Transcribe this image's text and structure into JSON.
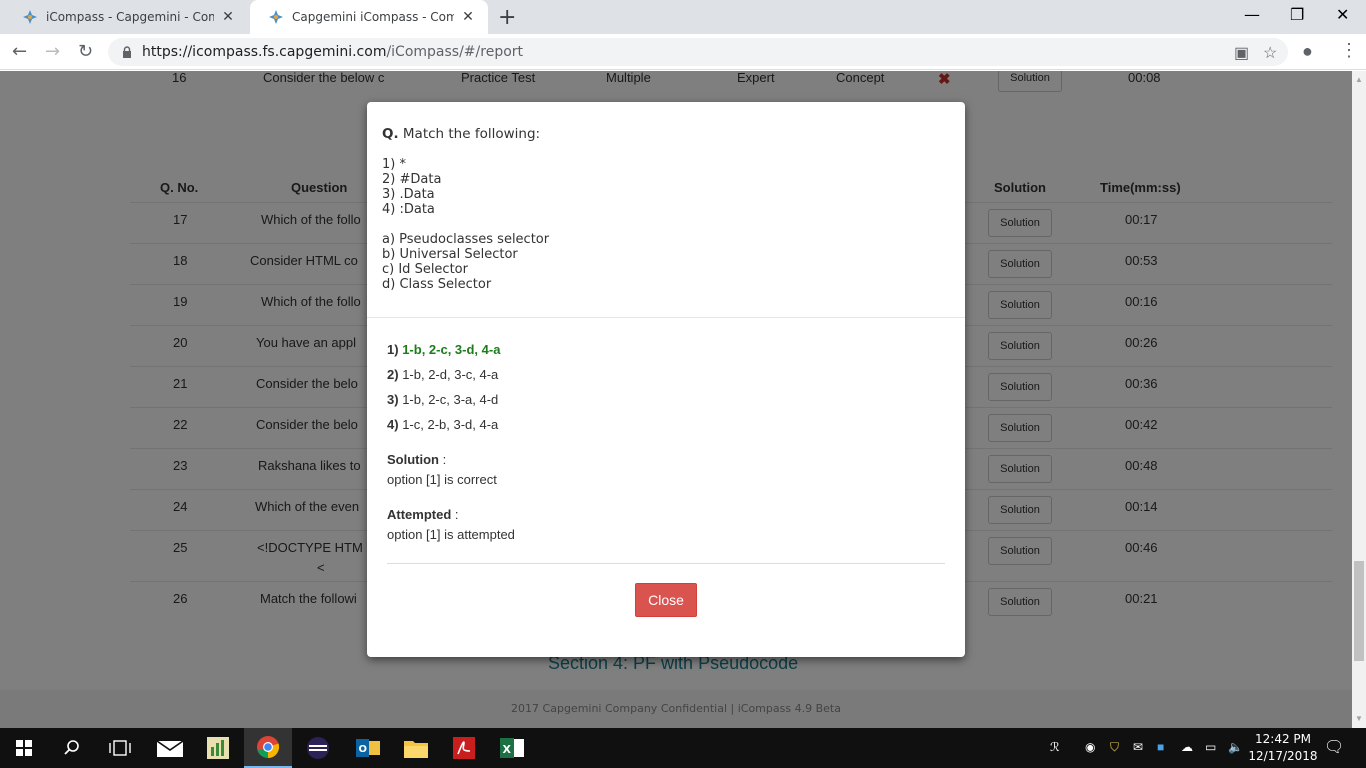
{
  "browser": {
    "tabs": [
      {
        "title": "iCompass - Capgemini - Compet"
      },
      {
        "title": "Capgemini iCompass - Compete"
      }
    ],
    "url_host": "https://icompass.fs.capgemini.com",
    "url_path": "/iCompass/#/report"
  },
  "table": {
    "top_row": {
      "qno": "16",
      "question": "Consider the below c",
      "test": "Practice Test",
      "type": "Multiple",
      "level": "Expert",
      "category": "Concept",
      "solution": "Solution",
      "time": "00:08"
    },
    "headers": {
      "qno": "Q. No.",
      "question": "Question",
      "solution": "Solution",
      "time": "Time(mm:ss)"
    },
    "rows": [
      {
        "qno": "17",
        "question": "Which of the follo",
        "solution": "Solution",
        "time": "00:17"
      },
      {
        "qno": "18",
        "question": "Consider HTML co",
        "solution": "Solution",
        "time": "00:53"
      },
      {
        "qno": "19",
        "question": "Which of the follo",
        "solution": "Solution",
        "time": "00:16"
      },
      {
        "qno": "20",
        "question": "You have an appl",
        "solution": "Solution",
        "time": "00:26"
      },
      {
        "qno": "21",
        "question": "Consider the belo",
        "solution": "Solution",
        "time": "00:36"
      },
      {
        "qno": "22",
        "question": "Consider the belo",
        "solution": "Solution",
        "time": "00:42"
      },
      {
        "qno": "23",
        "question": "Rakshana likes to",
        "solution": "Solution",
        "time": "00:48"
      },
      {
        "qno": "24",
        "question": "Which of the even",
        "solution": "Solution",
        "time": "00:14"
      },
      {
        "qno": "25",
        "question": "<!DOCTYPE HTM",
        "question2": "<",
        "solution": "Solution",
        "time": "00:46"
      },
      {
        "qno": "26",
        "question": "Match the followi",
        "solution": "Solution",
        "time": "00:21"
      }
    ],
    "section_title": "Section 4: PF with Pseudocode"
  },
  "footer": "2017 Capgemini Company Confidential | iCompass 4.9 Beta",
  "modal": {
    "q_prefix": "Q.",
    "q_text": "Match the following:",
    "items": [
      "1) *",
      "2) #Data",
      "3) .Data",
      "4) :Data"
    ],
    "choices": [
      "a) Pseudoclasses selector",
      "b) Universal Selector",
      "c) Id Selector",
      "d) Class Selector"
    ],
    "options": [
      {
        "num": "1)",
        "text": "1-b, 2-c, 3-d, 4-a"
      },
      {
        "num": "2)",
        "text": "1-b, 2-d, 3-c, 4-a"
      },
      {
        "num": "3)",
        "text": "1-b, 2-c, 3-a, 4-d"
      },
      {
        "num": "4)",
        "text": "1-c, 2-b, 3-d, 4-a"
      }
    ],
    "solution_label": "Solution",
    "solution_sep": " :",
    "solution_text": "option [1] is correct",
    "attempted_label": "Attempted",
    "attempted_sep": " :",
    "attempted_text": "option [1] is attempted",
    "close_label": "Close"
  },
  "taskbar": {
    "time": "12:42 PM",
    "date": "12/17/2018"
  }
}
